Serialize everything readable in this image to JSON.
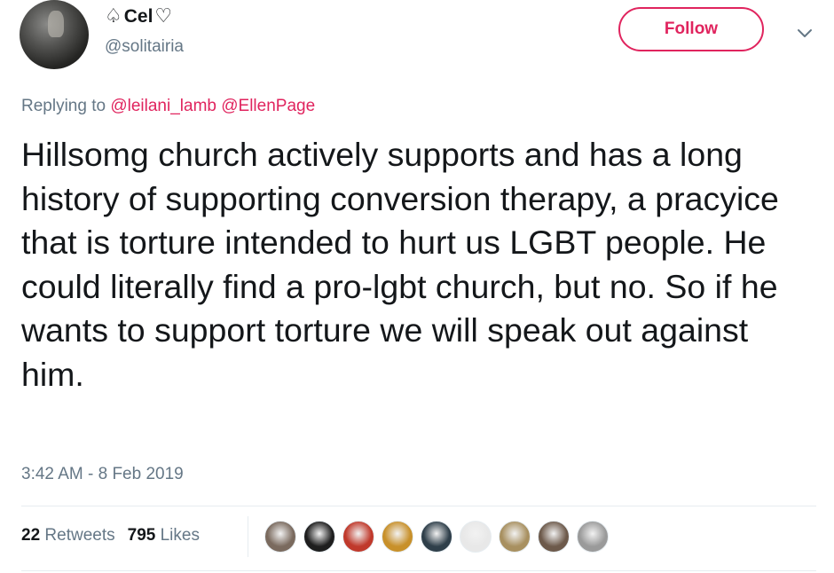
{
  "user": {
    "name_prefix_glyph": "♤",
    "name": "Cel",
    "name_suffix_glyph": "♡",
    "handle": "@solitairia"
  },
  "follow_button": {
    "label": "Follow",
    "color": "#e0245e"
  },
  "menu": {
    "icon": "chevron-down-icon"
  },
  "reply": {
    "prefix": "Replying to",
    "mentions": [
      "@leilani_lamb",
      "@EllenPage"
    ]
  },
  "tweet": {
    "text": "Hillsomg church actively supports and has a long history of supporting conversion therapy, a pracyice that is torture intended to hurt us LGBT people. He could literally find a pro-lgbt church, but no. So if he wants to support torture we will speak out against him."
  },
  "timestamp": "3:42 AM - 8 Feb 2019",
  "stats": {
    "retweets_count": "22",
    "retweets_label": "Retweets",
    "likes_count": "795",
    "likes_label": "Likes"
  },
  "likers": [
    {
      "name": "liker-avatar-1",
      "color": "#7a6a5e"
    },
    {
      "name": "liker-avatar-2",
      "color": "#1e1e1e"
    },
    {
      "name": "liker-avatar-3",
      "color": "#c0392b"
    },
    {
      "name": "liker-avatar-4",
      "color": "#c8902a"
    },
    {
      "name": "liker-avatar-5",
      "color": "#2f3f4a"
    },
    {
      "name": "liker-avatar-6",
      "color": "#e8e8e8"
    },
    {
      "name": "liker-avatar-7",
      "color": "#a89060"
    },
    {
      "name": "liker-avatar-8",
      "color": "#6d5a4b"
    },
    {
      "name": "liker-avatar-9",
      "color": "#9a9a9a"
    }
  ]
}
